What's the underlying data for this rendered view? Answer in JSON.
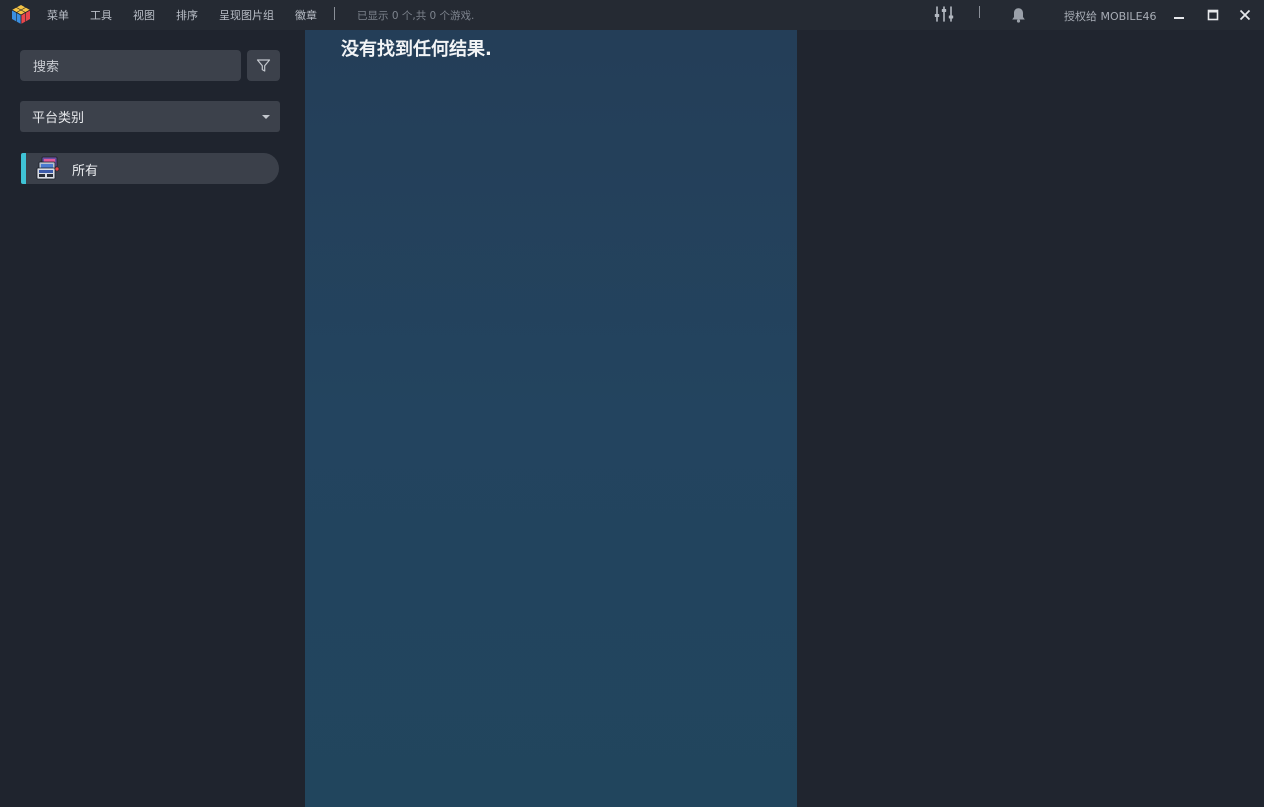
{
  "titlebar": {
    "menu": [
      "菜单",
      "工具",
      "视图",
      "排序",
      "呈现图片组",
      "徽章"
    ],
    "status": "已显示 0 个,共 0 个游戏.",
    "license": "授权给 MOBILE46",
    "icons": [
      "app-cube-icon",
      "sliders-icon",
      "bell-icon",
      "minimize-icon",
      "maximize-icon",
      "close-icon"
    ]
  },
  "sidebar": {
    "search_placeholder": "搜索",
    "platform_select": "平台类别",
    "categories": [
      {
        "label": "所有",
        "active": true
      }
    ],
    "accent_color": "#3fc3d6"
  },
  "main": {
    "empty_message": "没有找到任何结果."
  }
}
